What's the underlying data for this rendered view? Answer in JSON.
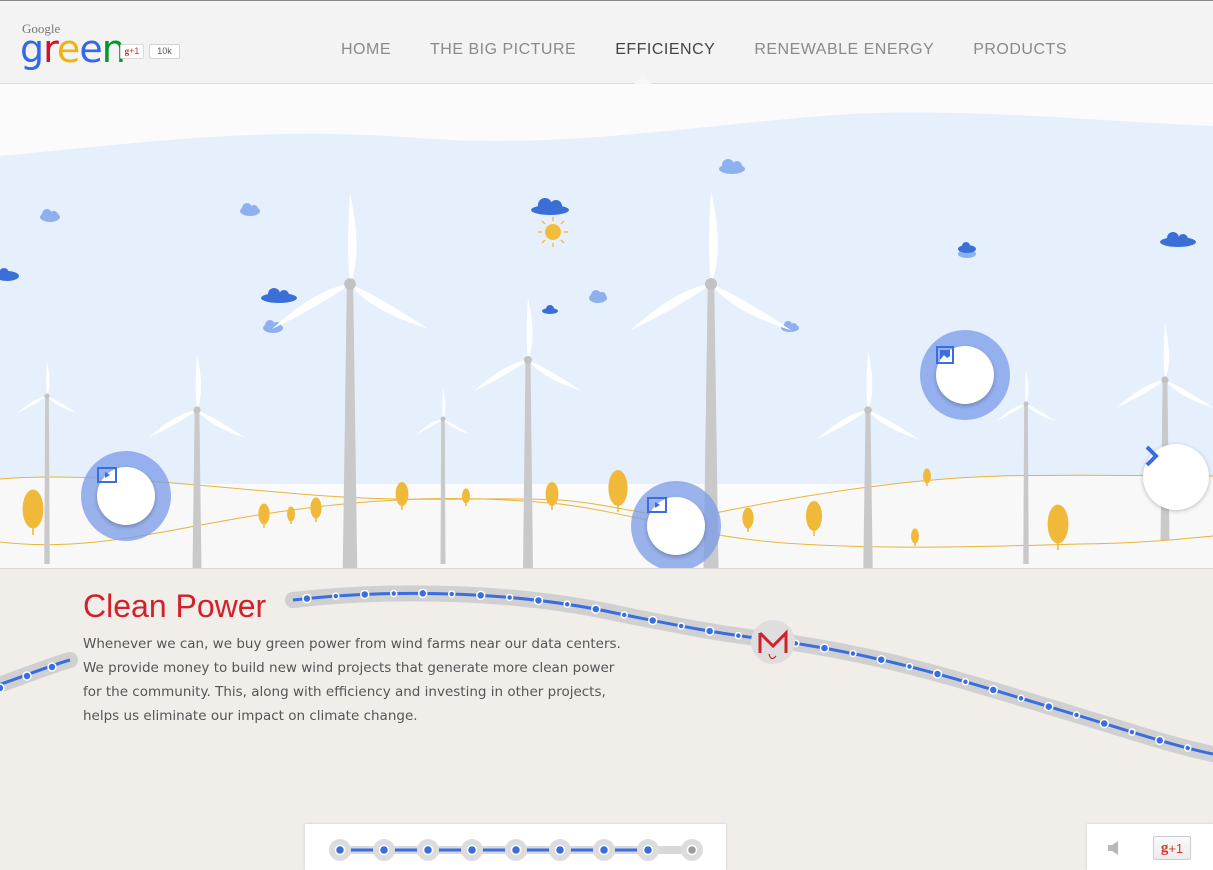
{
  "header": {
    "logo_google": "Google",
    "logo_green": [
      "g",
      "r",
      "e",
      "e",
      "n"
    ],
    "logo_colors": [
      "#3369e8",
      "#d50f25",
      "#eeb211",
      "#3369e8",
      "#009925"
    ],
    "plusone_label": "+1",
    "plusone_count": "10k"
  },
  "nav": {
    "items": [
      {
        "label": "HOME",
        "active": false
      },
      {
        "label": "THE BIG PICTURE",
        "active": false
      },
      {
        "label": "EFFICIENCY",
        "active": true
      },
      {
        "label": "RENEWABLE ENERGY",
        "active": false
      },
      {
        "label": "PRODUCTS",
        "active": false
      }
    ]
  },
  "scene": {
    "sky_color": "#e6f0fd",
    "ground_color": "#f8f8f8",
    "hill_line_color": "#e6b53a",
    "tree_color": "#f0b93a",
    "cloud_dark": "#3b6fd8",
    "cloud_light": "#8fb0ee",
    "sun_color": "#f3bd3c",
    "hotspots": [
      {
        "name": "video-hotspot-left",
        "icon": "play-icon"
      },
      {
        "name": "video-hotspot-center",
        "icon": "play-icon"
      },
      {
        "name": "image-hotspot-right",
        "icon": "image-icon"
      }
    ],
    "next_icon": "chevron-right-icon"
  },
  "content": {
    "title": "Clean Power",
    "lines": [
      "Whenever we can, we buy green power from wind farms near our data centers.",
      "We provide money to build new wind projects that generate more clean power",
      "for the community. This, along with efficiency and investing in other projects,",
      "helps us eliminate our impact on climate change."
    ]
  },
  "track": {
    "line_color": "#3a6ee0",
    "marker_icon": "gmail-icon"
  },
  "progress": {
    "total_steps": 9,
    "completed_steps": 8
  },
  "share": {
    "speaker_icon": "speaker-icon",
    "plusone_label": "+1"
  },
  "colors": {
    "accent_red": "#d4202a",
    "accent_blue": "#3a6ee0"
  }
}
